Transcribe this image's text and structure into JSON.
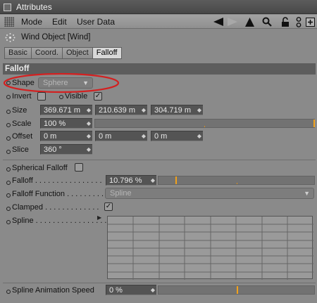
{
  "window": {
    "title": "Attributes"
  },
  "menu": {
    "items": [
      "Mode",
      "Edit",
      "User Data"
    ]
  },
  "toolbar_icons": [
    "arrow-left-icon",
    "arrow-right-icon",
    "arrow-up-icon",
    "search-icon",
    "lock-icon",
    "hierarchy-icon",
    "new-panel-icon"
  ],
  "object": {
    "name": "Wind Object [Wind]",
    "icon": "wind-object-icon"
  },
  "tabs": [
    {
      "label": "Basic",
      "active": false
    },
    {
      "label": "Coord.",
      "active": false
    },
    {
      "label": "Object",
      "active": false
    },
    {
      "label": "Falloff",
      "active": true
    }
  ],
  "section_title": "Falloff",
  "shape": {
    "label": "Shape",
    "value": "Sphere"
  },
  "invert": {
    "label": "Invert",
    "checked": false
  },
  "visible": {
    "label": "Visible",
    "checked": true
  },
  "size": {
    "label": "Size",
    "values": [
      "369.671 m",
      "210.639 m",
      "304.719 m"
    ]
  },
  "scale": {
    "label": "Scale",
    "value": "100 %"
  },
  "offset": {
    "label": "Offset",
    "values": [
      "0 m",
      "0 m",
      "0 m"
    ]
  },
  "slice": {
    "label": "Slice",
    "value": "360 °"
  },
  "spherical_falloff": {
    "label": "Spherical Falloff",
    "checked": false
  },
  "falloff": {
    "label": "Falloff",
    "value": "10.796 %",
    "fraction": 0.108
  },
  "falloff_function": {
    "label": "Falloff Function",
    "value": "Spline"
  },
  "clamped": {
    "label": "Clamped",
    "checked": true
  },
  "spline": {
    "label": "Spline"
  },
  "spline_animation_speed": {
    "label": "Spline Animation Speed",
    "value": "0 %",
    "fraction": 0.0
  },
  "colors": {
    "highlight": "#d32020",
    "slider_marker": "#f2a21c",
    "section_bg": "#5d5d5d"
  }
}
